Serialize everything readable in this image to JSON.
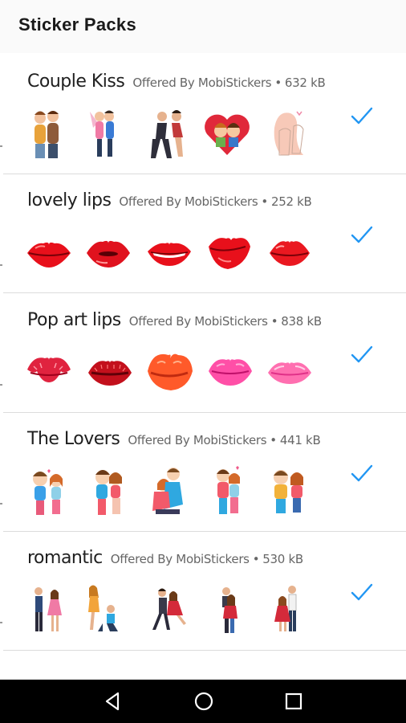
{
  "app_bar": {
    "title": "Sticker Packs"
  },
  "packs": [
    {
      "name": "Couple Kiss",
      "publisher": "Offered By MobiStickers",
      "size": "632 kB",
      "stickers": [
        "couple-kiss-sticker-1",
        "couple-kiss-sticker-2",
        "couple-kiss-sticker-3",
        "couple-kiss-sticker-4",
        "couple-kiss-sticker-5"
      ]
    },
    {
      "name": "lovely lips",
      "publisher": "Offered By MobiStickers",
      "size": "252 kB",
      "stickers": [
        "lips-sticker-1",
        "lips-sticker-2",
        "lips-sticker-3",
        "lips-sticker-4",
        "lips-sticker-5"
      ]
    },
    {
      "name": "Pop art lips",
      "publisher": "Offered By MobiStickers",
      "size": "838 kB",
      "stickers": [
        "kiss-print-sticker-1",
        "kiss-print-sticker-2",
        "kiss-print-sticker-3",
        "kiss-print-sticker-4",
        "kiss-print-sticker-5"
      ]
    },
    {
      "name": "The Lovers",
      "publisher": "Offered By MobiStickers",
      "size": "441 kB",
      "stickers": [
        "lovers-sticker-1",
        "lovers-sticker-2",
        "lovers-sticker-3",
        "lovers-sticker-4",
        "lovers-sticker-5"
      ]
    },
    {
      "name": "romantic",
      "publisher": "Offered By MobiStickers",
      "size": "530 kB",
      "stickers": [
        "romantic-sticker-1",
        "romantic-sticker-2",
        "romantic-sticker-3",
        "romantic-sticker-4",
        "romantic-sticker-5"
      ]
    }
  ],
  "status_icon": "checkmark-icon",
  "colors": {
    "accent": "#2196f3",
    "lip_red": "#e8101b",
    "pop_pink": "#ff4fa7",
    "nav_bg": "#000000"
  },
  "nav": {
    "back": "back-icon",
    "home": "home-icon",
    "recents": "recents-icon"
  }
}
